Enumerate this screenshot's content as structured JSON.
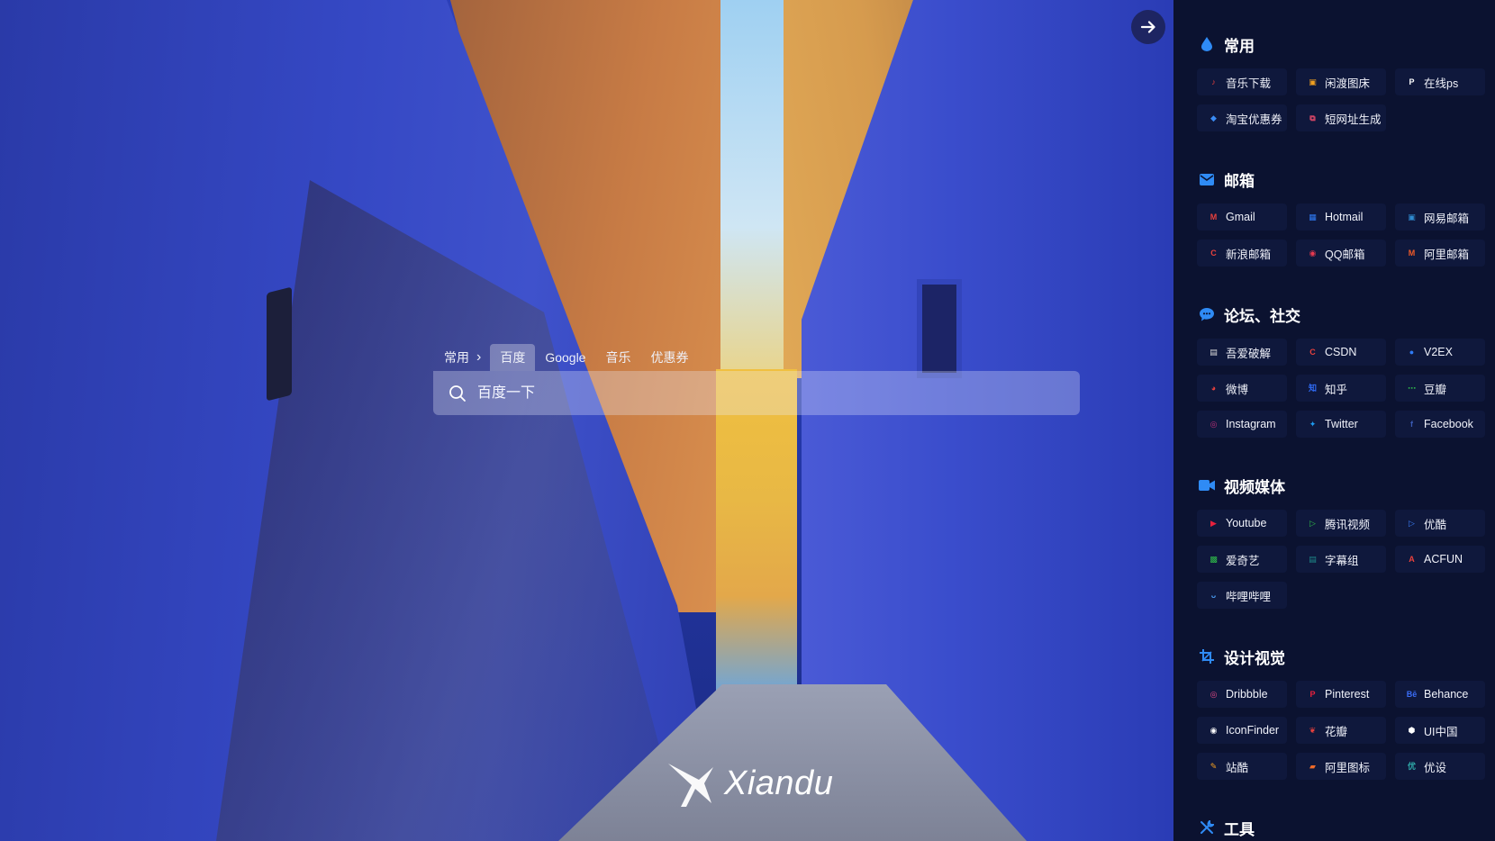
{
  "search": {
    "category": "常用",
    "tabs": [
      "百度",
      "Google",
      "音乐",
      "优惠券"
    ],
    "active_tab": "百度",
    "placeholder": "百度一下"
  },
  "logo": {
    "text": "Xiandu"
  },
  "colors": {
    "sidebar_bg": "#0b1230",
    "link_bg": "#0f183c",
    "accent": "#2f7bf5"
  },
  "sidebar": {
    "sections": [
      {
        "title": "常用",
        "icon": "drop-icon",
        "icon_color": "#2f8bf5",
        "links": [
          {
            "label": "音乐下载",
            "icon": "music-icon",
            "color": "#e8413d",
            "glyph": "♪"
          },
          {
            "label": "闲渡图床",
            "icon": "image-icon",
            "color": "#f0a020",
            "glyph": "▣"
          },
          {
            "label": "在线ps",
            "icon": "ps-icon",
            "color": "#ffffff",
            "glyph": "P"
          },
          {
            "label": "淘宝优惠券",
            "icon": "diamond-icon",
            "color": "#3a8cf5",
            "glyph": "◆"
          },
          {
            "label": "短网址生成",
            "icon": "link-icon",
            "color": "#e84a6a",
            "glyph": "⧉"
          }
        ]
      },
      {
        "title": "邮箱",
        "icon": "mail-icon",
        "icon_color": "#2f8bf5",
        "links": [
          {
            "label": "Gmail",
            "icon": "gmail-icon",
            "color": "#e8413d",
            "glyph": "M"
          },
          {
            "label": "Hotmail",
            "icon": "windows-icon",
            "color": "#2f7bf5",
            "glyph": "▦"
          },
          {
            "label": "网易邮箱",
            "icon": "netease-mail-icon",
            "color": "#2f8bd0",
            "glyph": "▣"
          },
          {
            "label": "新浪邮箱",
            "icon": "sina-mail-icon",
            "color": "#e8413d",
            "glyph": "C"
          },
          {
            "label": "QQ邮箱",
            "icon": "qq-icon",
            "color": "#e83a50",
            "glyph": "◉"
          },
          {
            "label": "阿里邮箱",
            "icon": "ali-mail-icon",
            "color": "#f05a28",
            "glyph": "M"
          }
        ]
      },
      {
        "title": "论坛、社交",
        "icon": "chat-icon",
        "icon_color": "#2f8bf5",
        "links": [
          {
            "label": "吾爱破解",
            "icon": "52pojie-icon",
            "color": "#dddddd",
            "glyph": "▤"
          },
          {
            "label": "CSDN",
            "icon": "csdn-icon",
            "color": "#e8413d",
            "glyph": "C"
          },
          {
            "label": "V2EX",
            "icon": "v2ex-icon",
            "color": "#2f7bf5",
            "glyph": "●"
          },
          {
            "label": "微博",
            "icon": "weibo-icon",
            "color": "#e8413d",
            "glyph": "◕"
          },
          {
            "label": "知乎",
            "icon": "zhihu-icon",
            "color": "#2f6bf5",
            "glyph": "知"
          },
          {
            "label": "豆瓣",
            "icon": "douban-icon",
            "color": "#2aa84a",
            "glyph": "⋯"
          },
          {
            "label": "Instagram",
            "icon": "instagram-icon",
            "color": "#c0307a",
            "glyph": "◎"
          },
          {
            "label": "Twitter",
            "icon": "twitter-icon",
            "color": "#1d9bf0",
            "glyph": "✦"
          },
          {
            "label": "Facebook",
            "icon": "facebook-icon",
            "color": "#3b5bb5",
            "glyph": "f"
          }
        ]
      },
      {
        "title": "视频媒体",
        "icon": "video-icon",
        "icon_color": "#2f8bf5",
        "links": [
          {
            "label": "Youtube",
            "icon": "youtube-icon",
            "color": "#e8213d",
            "glyph": "▶"
          },
          {
            "label": "腾讯视频",
            "icon": "tencent-video-icon",
            "color": "#2fb84a",
            "glyph": "▷"
          },
          {
            "label": "优酷",
            "icon": "youku-icon",
            "color": "#3a7cf5",
            "glyph": "▷"
          },
          {
            "label": "爱奇艺",
            "icon": "iqiyi-icon",
            "color": "#2fb84a",
            "glyph": "▩"
          },
          {
            "label": "字幕组",
            "icon": "subtitle-icon",
            "color": "#1e8a8a",
            "glyph": "▤"
          },
          {
            "label": "ACFUN",
            "icon": "acfun-icon",
            "color": "#e8413d",
            "glyph": "A"
          },
          {
            "label": "哔哩哔哩",
            "icon": "bilibili-icon",
            "color": "#4a9bf0",
            "glyph": "ᴗ"
          }
        ]
      },
      {
        "title": "设计视觉",
        "icon": "crop-icon",
        "icon_color": "#2f8bf5",
        "links": [
          {
            "label": "Dribbble",
            "icon": "dribbble-icon",
            "color": "#ea4c89",
            "glyph": "◎"
          },
          {
            "label": "Pinterest",
            "icon": "pinterest-icon",
            "color": "#e8213d",
            "glyph": "P"
          },
          {
            "label": "Behance",
            "icon": "behance-icon",
            "color": "#3a6cf5",
            "glyph": "Bē"
          },
          {
            "label": "IconFinder",
            "icon": "eye-icon",
            "color": "#ffffff",
            "glyph": "◉"
          },
          {
            "label": "花瓣",
            "icon": "huaban-icon",
            "color": "#e8413d",
            "glyph": "❦"
          },
          {
            "label": "UI中国",
            "icon": "ui-china-icon",
            "color": "#ffffff",
            "glyph": "⬢"
          },
          {
            "label": "站酷",
            "icon": "zcool-icon",
            "color": "#f5a020",
            "glyph": "✎"
          },
          {
            "label": "阿里图标",
            "icon": "iconfont-icon",
            "color": "#f06a28",
            "glyph": "▰"
          },
          {
            "label": "优设",
            "icon": "uisdc-icon",
            "color": "#2fa8a8",
            "glyph": "优"
          }
        ]
      },
      {
        "title": "工具",
        "icon": "tools-icon",
        "icon_color": "#2f8bf5",
        "links": []
      }
    ]
  }
}
